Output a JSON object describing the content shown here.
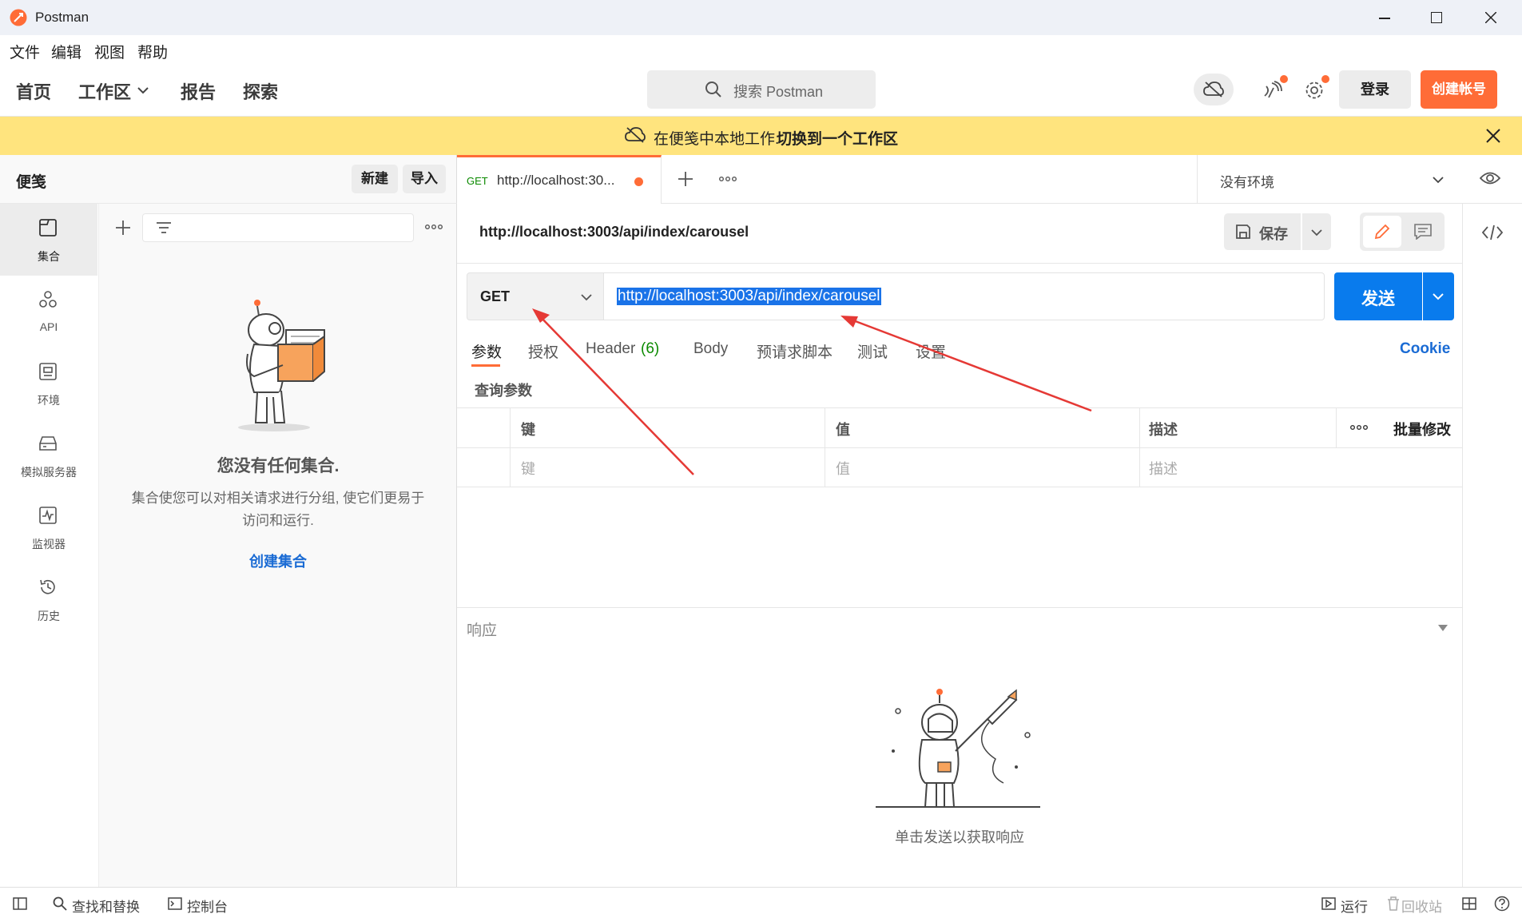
{
  "app": {
    "title": "Postman"
  },
  "menu": {
    "file": "文件",
    "edit": "编辑",
    "view": "视图",
    "help": "帮助"
  },
  "header": {
    "home": "首页",
    "workspaces": "工作区",
    "reports": "报告",
    "explore": "探索",
    "search_placeholder": "搜索 Postman",
    "signin": "登录",
    "signup": "创建帐号"
  },
  "banner": {
    "text": "在便笺中本地工作.",
    "link": "切换到一个工作区"
  },
  "sidebar": {
    "title": "便笺",
    "new_label": "新建",
    "import_label": "导入",
    "rail": [
      {
        "label": "集合",
        "icon": "collection-icon"
      },
      {
        "label": "API",
        "icon": "api-icon"
      },
      {
        "label": "环境",
        "icon": "environment-icon"
      },
      {
        "label": "模拟服务器",
        "icon": "mock-server-icon"
      },
      {
        "label": "监视器",
        "icon": "monitor-icon"
      },
      {
        "label": "历史",
        "icon": "history-icon"
      }
    ],
    "empty_title": "您没有任何集合.",
    "empty_desc_1": "集合使您可以对相关请求进行分组, 使它们更易于",
    "empty_desc_2": "访问和运行.",
    "create_collection": "创建集合"
  },
  "tabs": {
    "active": {
      "method": "GET",
      "label": "http://localhost:30..."
    },
    "environment": "没有环境"
  },
  "request": {
    "name": "http://localhost:3003/api/index/carousel",
    "save_label": "保存",
    "method": "GET",
    "url": "http://localhost:3003/api/index/carousel",
    "send_label": "发送",
    "tabs": {
      "params": "参数",
      "auth": "授权",
      "headers": "Header",
      "headers_count": "(6)",
      "body": "Body",
      "prerequest": "预请求脚本",
      "tests": "测试",
      "settings": "设置"
    },
    "cookies": "Cookie",
    "query_params_title": "查询参数",
    "table": {
      "col_key": "键",
      "col_value": "值",
      "col_desc": "描述",
      "bulk_edit": "批量修改",
      "ph_key": "键",
      "ph_value": "值",
      "ph_desc": "描述"
    }
  },
  "response": {
    "title": "响应",
    "empty_hint": "单击发送以获取响应"
  },
  "statusbar": {
    "find_replace": "查找和替换",
    "console": "控制台",
    "runner": "运行",
    "trash": "回收站"
  },
  "colors": {
    "accent": "#ff6c37",
    "send_blue": "#097bed",
    "banner": "#ffe47e",
    "annotation": "#e53935"
  }
}
